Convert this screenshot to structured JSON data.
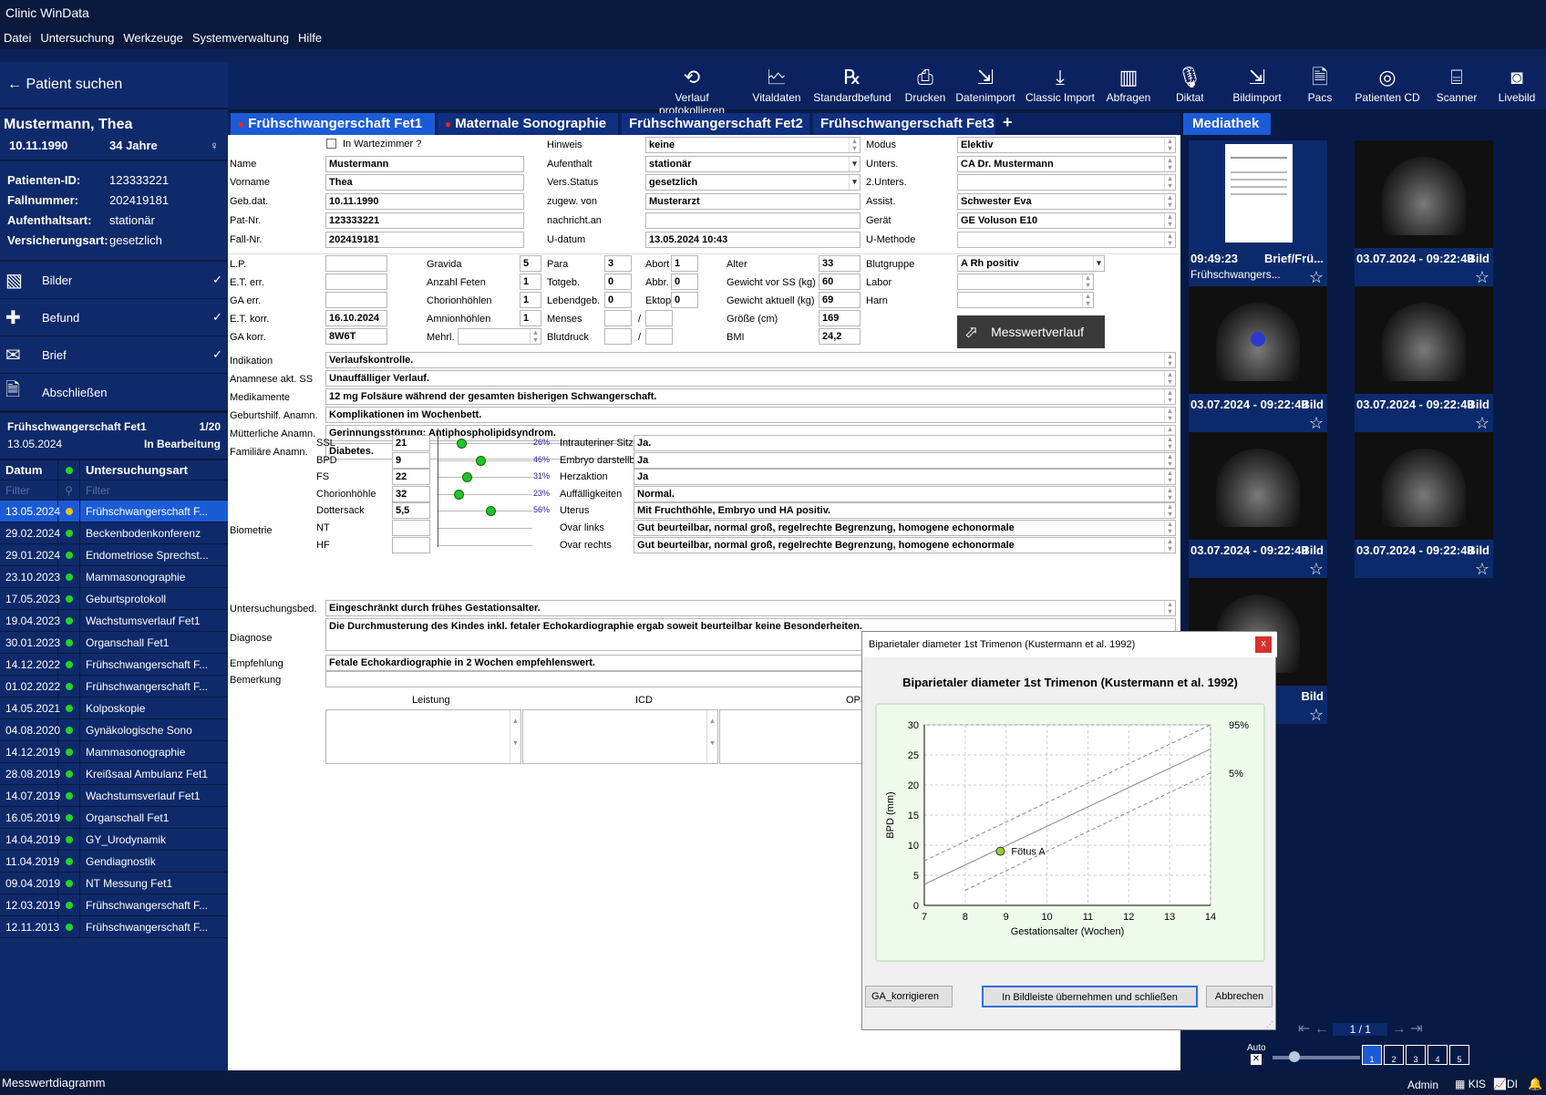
{
  "app": {
    "title": "Clinic WinData"
  },
  "menu": [
    "Datei",
    "Untersuchung",
    "Werkzeuge",
    "Systemverwaltung",
    "Hilfe"
  ],
  "sidebar": {
    "search_label": "Patient suchen",
    "patient_name": "Mustermann, Thea",
    "dob": "10.11.1990",
    "age": "34 Jahre",
    "info": [
      {
        "k": "Patienten-ID:",
        "v": "123333221"
      },
      {
        "k": "Fallnummer:",
        "v": "202419181"
      },
      {
        "k": "Aufenthaltsart:",
        "v": "stationär"
      },
      {
        "k": "Versicherungsart:",
        "v": "gesetzlich"
      }
    ],
    "nav": [
      {
        "label": "Bilder",
        "checked": true
      },
      {
        "label": "Befund",
        "checked": true
      },
      {
        "label": "Brief",
        "checked": true
      },
      {
        "label": "Abschließen",
        "checked": false
      }
    ],
    "fet_title": "Frühschwangerschaft Fet1",
    "fet_count": "1/20",
    "fet_date": "13.05.2024",
    "fet_status": "In Bearbeitung",
    "col_date": "Datum",
    "col_type": "Untersuchungsart",
    "filter_date": "Filter",
    "filter_type": "Filter",
    "rows": [
      {
        "date": "13.05.2024",
        "type": "Frühschwangerschaft F...",
        "status": "yellow"
      },
      {
        "date": "29.02.2024",
        "type": "Beckenbodenkonferenz",
        "status": "green"
      },
      {
        "date": "29.01.2024",
        "type": "Endometriose Sprechst...",
        "status": "green"
      },
      {
        "date": "23.10.2023",
        "type": "Mammasonographie",
        "status": "green"
      },
      {
        "date": "17.05.2023",
        "type": "Geburtsprotokoll",
        "status": "green"
      },
      {
        "date": "19.04.2023",
        "type": "Wachstumsverlauf Fet1",
        "status": "green"
      },
      {
        "date": "30.01.2023",
        "type": "Organschall Fet1",
        "status": "green"
      },
      {
        "date": "14.12.2022",
        "type": "Frühschwangerschaft F...",
        "status": "green"
      },
      {
        "date": "01.02.2022",
        "type": "Frühschwangerschaft F...",
        "status": "green"
      },
      {
        "date": "14.05.2021",
        "type": "Kolposkopie",
        "status": "green"
      },
      {
        "date": "04.08.2020",
        "type": "Gynäkologische Sono",
        "status": "green"
      },
      {
        "date": "14.12.2019",
        "type": "Mammasonographie",
        "status": "green"
      },
      {
        "date": "28.08.2019",
        "type": "Kreißsaal Ambulanz Fet1",
        "status": "green"
      },
      {
        "date": "14.07.2019",
        "type": "Wachstumsverlauf Fet1",
        "status": "green"
      },
      {
        "date": "16.05.2019",
        "type": "Organschall Fet1",
        "status": "green"
      },
      {
        "date": "14.04.2019",
        "type": "GY_Urodynamik",
        "status": "green"
      },
      {
        "date": "11.04.2019",
        "type": "Gendiagnostik",
        "status": "green"
      },
      {
        "date": "09.04.2019",
        "type": "NT Messung Fet1",
        "status": "green"
      },
      {
        "date": "12.03.2019",
        "type": "Frühschwangerschaft F...",
        "status": "green"
      },
      {
        "date": "12.11.2013",
        "type": "Frühschwangerschaft F...",
        "status": "green"
      }
    ]
  },
  "toolbar": [
    "Verlauf protokollieren",
    "Vitaldaten",
    "Standardbefund",
    "Drucken",
    "Datenimport",
    "Classic Import",
    "Abfragen",
    "Diktat",
    "Bildimport",
    "Pacs",
    "Patienten CD",
    "Scanner",
    "Livebild"
  ],
  "tabs": [
    "Frühschwangerschaft Fet1",
    "Maternale Sonographie",
    "Frühschwangerschaft Fet2",
    "Frühschwangerschaft Fet3",
    "+"
  ],
  "form": {
    "wartezimmer": "In Wartezimmer ?",
    "l_name": "Name",
    "name": "Mustermann",
    "l_vorname": "Vorname",
    "vorname": "Thea",
    "l_geb": "Geb.dat.",
    "geb": "10.11.1990",
    "l_pat": "Pat-Nr.",
    "pat": "123333221",
    "l_fall": "Fall-Nr.",
    "fall": "202419181",
    "l_hinweis": "Hinweis",
    "hinweis": "keine",
    "l_aufenthalt": "Aufenthalt",
    "aufenthalt": "stationär",
    "l_vers": "Vers.Status",
    "vers": "gesetzlich",
    "l_zugew": "zugew. von",
    "zugew": "Musterarzt",
    "l_nachricht": "nachricht.an",
    "nachricht": "",
    "l_udatum": "U-datum",
    "udatum": "13.05.2024 10:43",
    "l_modus": "Modus",
    "modus": "Elektiv",
    "l_unters": "Unters.",
    "unters": "CA Dr. Mustermann",
    "l_unters2": "2.Unters.",
    "unters2": "",
    "l_assist": "Assist.",
    "assist": "Schwester Eva",
    "l_geraet": "Gerät",
    "geraet": "GE Voluson E10",
    "l_umethode": "U-Methode",
    "umethode": "",
    "l_lp": "L.P.",
    "l_eterr": "E.T. err.",
    "l_gaerr": "GA err.",
    "l_etkorr": "E.T. korr.",
    "etkorr": "16.10.2024",
    "l_gakorr": "GA korr.",
    "gakorr": "8W6T",
    "l_gravida": "Gravida",
    "gravida": "5",
    "l_feten": "Anzahl Feten",
    "feten": "1",
    "l_chorion": "Chorionhöhlen",
    "chorion": "1",
    "l_amnion": "Amnionhöhlen",
    "amnion": "1",
    "l_mehrl": "Mehrl.",
    "l_para": "Para",
    "para": "3",
    "l_totgeb": "Totgeb.",
    "totgeb": "0",
    "l_lebend": "Lebendgeb.",
    "lebend": "0",
    "l_menses": "Menses",
    "l_blutdruck": "Blutdruck",
    "l_abort": "Abort",
    "abort": "1",
    "l_abbr": "Abbr.",
    "abbr": "0",
    "l_ektop": "Ektop",
    "ektop": "0",
    "l_alter": "Alter",
    "alter": "33",
    "l_gvss": "Gewicht vor SS (kg)",
    "gvss": "60",
    "l_gakt": "Gewicht aktuell (kg)",
    "gakt": "69",
    "l_groesse": "Größe (cm)",
    "groesse": "169",
    "l_bmi": "BMI",
    "bmi": "24,2",
    "l_blutgruppe": "Blutgruppe",
    "blutgruppe": "A Rh positiv",
    "l_labor": "Labor",
    "l_harn": "Harn",
    "messwert_btn": "Messwertverlauf",
    "l_indikation": "Indikation",
    "indikation": "Verlaufskontrolle.",
    "l_anamnese": "Anamnese akt. SS",
    "anamnese": "Unauffälliger Verlauf.",
    "l_medikamente": "Medikamente",
    "medikamente": "12 mg Folsäure während der gesamten bisherigen Schwangerschaft.",
    "l_geburtsh": "Geburtshilf. Anamn.",
    "geburtsh": "Komplikationen im Wochenbett.",
    "l_muetter": "Mütterliche Anamn.",
    "muetter": "Gerinnungsstörung: Antiphospholipidsyndrom.",
    "l_familiaer": "Familiäre Anamn.",
    "familiaer": "Diabetes.",
    "l_biometrie": "Biometrie",
    "biometrie": [
      {
        "label": "SSL",
        "value": "21",
        "pct": "26%",
        "p": 0.26
      },
      {
        "label": "BPD",
        "value": "9",
        "pct": "46%",
        "p": 0.46
      },
      {
        "label": "FS",
        "value": "22",
        "pct": "31%",
        "p": 0.31
      },
      {
        "label": "Chorionhöhle",
        "value": "32",
        "pct": "23%",
        "p": 0.23
      },
      {
        "label": "Dottersack",
        "value": "5,5",
        "pct": "56%",
        "p": 0.56
      },
      {
        "label": "NT",
        "value": "",
        "pct": "",
        "p": null
      },
      {
        "label": "HF",
        "value": "",
        "pct": "",
        "p": null
      }
    ],
    "findings": [
      {
        "label": "Intrauteriner Sitz",
        "value": "Ja."
      },
      {
        "label": "Embryo darstellb.",
        "value": "Ja"
      },
      {
        "label": "Herzaktion",
        "value": "Ja"
      },
      {
        "label": "Auffälligkeiten",
        "value": "Normal."
      },
      {
        "label": "Uterus",
        "value": "Mit Fruchthöhle, Embryo und HA positiv."
      },
      {
        "label": "Ovar links",
        "value": "Gut beurteilbar, normal groß, regelrechte Begrenzung, homogene echonormale"
      },
      {
        "label": "Ovar rechts",
        "value": "Gut beurteilbar, normal groß, regelrechte Begrenzung, homogene echonormale"
      }
    ],
    "l_ubed": "Untersuchungsbed.",
    "ubed": "Eingeschränkt durch frühes Gestationsalter.",
    "l_diagnose": "Diagnose",
    "diagnose": "Die Durchmusterung des Kindes inkl. fetaler Echokardiographie ergab soweit beurteilbar keine Besonderheiten.",
    "l_empfehlung": "Empfehlung",
    "empfehlung": "Fetale Echokardiographie in 2 Wochen empfehlenswert.",
    "l_bemerkung": "Bemerkung",
    "bemerkung": "",
    "col_leistung": "Leistung",
    "col_icd": "ICD",
    "col_ops": "OPS"
  },
  "media": {
    "tab": "Mediathek",
    "items": [
      {
        "caption": "09:49:23",
        "kind": "Brief/Frü...",
        "sub": "Frühschwangers..."
      },
      {
        "caption": "03.07.2024 - 09:22:49",
        "kind": "Bild"
      },
      {
        "caption": "03.07.2024 - 09:22:49",
        "kind": "Bild"
      },
      {
        "caption": "03.07.2024 - 09:22:49",
        "kind": "Bild"
      },
      {
        "caption": "03.07.2024 - 09:22:49",
        "kind": "Bild"
      },
      {
        "caption": "03.07.2024 - 09:22:49",
        "kind": "Bild"
      },
      {
        "caption": "22:49",
        "kind": "Bild"
      }
    ],
    "page": "1 / 1",
    "auto": "Auto",
    "grid_labels": [
      "1",
      "2",
      "3",
      "4",
      "5"
    ]
  },
  "dialog": {
    "window_title": "Biparietaler diameter 1st Trimenon (Kustermann et al. 1992)",
    "close": "x",
    "btn_ga": "GA_korrigieren",
    "btn_take": "In Bildleiste übernehmen und schließen",
    "btn_cancel": "Abbrechen"
  },
  "chart_data": {
    "type": "line",
    "title": "Biparietaler diameter 1st Trimenon (Kustermann et al. 1992)",
    "xlabel": "Gestationsalter (Wochen)",
    "ylabel": "BPD (mm)",
    "xlim": [
      7,
      14
    ],
    "ylim": [
      0,
      30
    ],
    "xticks": [
      7,
      8,
      9,
      10,
      11,
      12,
      13,
      14
    ],
    "yticks": [
      0,
      5,
      10,
      15,
      20,
      25,
      30
    ],
    "grid": true,
    "series": [
      {
        "name": "95%",
        "style": "dashed",
        "x": [
          7,
          14
        ],
        "y": [
          7.4,
          30
        ]
      },
      {
        "name": "",
        "style": "solid",
        "x": [
          7,
          14
        ],
        "y": [
          3.5,
          26
        ]
      },
      {
        "name": "5%",
        "style": "dashed",
        "x": [
          8,
          14
        ],
        "y": [
          2.5,
          22
        ]
      }
    ],
    "points": [
      {
        "name": "Fötus A",
        "x": 8.86,
        "y": 9
      }
    ]
  },
  "status": {
    "left": "Messwertdiagramm",
    "user": "Admin",
    "kis": "KIS",
    "di": "DI"
  }
}
